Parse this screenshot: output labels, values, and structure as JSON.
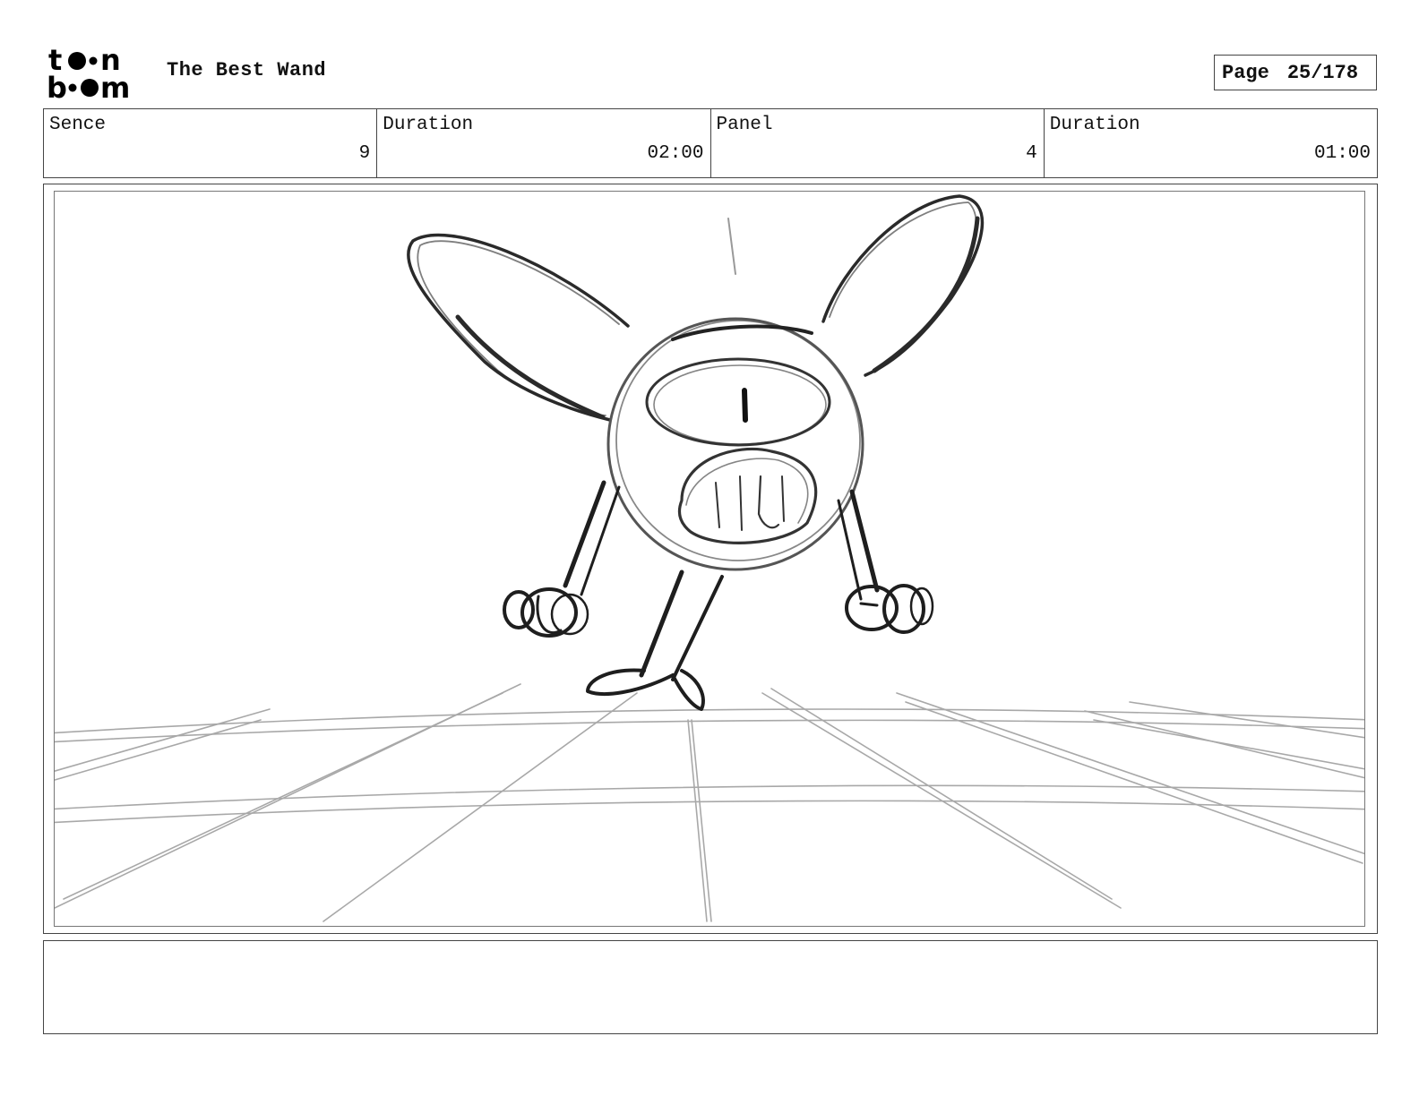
{
  "header": {
    "logo_text": "toon boom",
    "title": "The Best Wand",
    "page_label": "Page",
    "page_value": "25/178"
  },
  "info": [
    {
      "label": "Sence",
      "value": "9"
    },
    {
      "label": "Duration",
      "value": "02:00"
    },
    {
      "label": "Panel",
      "value": "4"
    },
    {
      "label": "Duration",
      "value": "01:00"
    }
  ],
  "panel": {
    "sketch": "character-sketch-icon"
  },
  "notes": {
    "text": ""
  }
}
